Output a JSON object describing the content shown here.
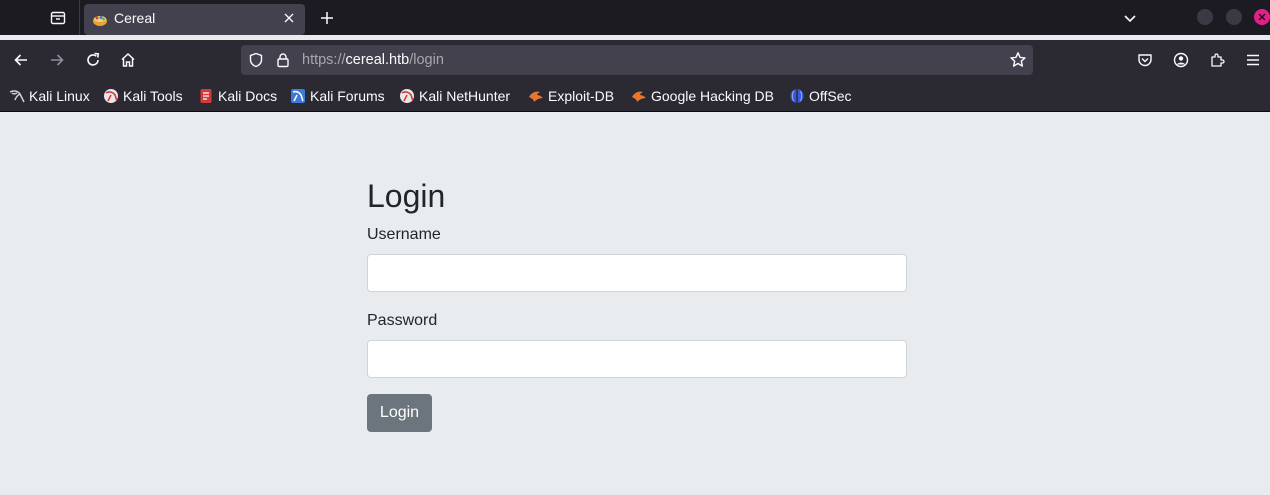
{
  "browser": {
    "tab": {
      "title": "Cereal",
      "active": true
    },
    "url": {
      "scheme": "https://",
      "host": "cereal.htb",
      "path": "/login"
    },
    "colors": {
      "tabbar": "#1c1b22",
      "toolbar": "#2b2a33",
      "urlbar": "#42414d",
      "close_button": "#e0218a"
    },
    "icons": [
      "tab-list-icon",
      "close-icon",
      "plus-icon",
      "chevron-down-icon",
      "back-arrow-icon",
      "forward-arrow-icon",
      "reload-icon",
      "home-icon",
      "shield-icon",
      "lock-icon",
      "star-icon",
      "pocket-icon",
      "account-icon",
      "extensions-icon",
      "menu-icon"
    ]
  },
  "bookmarks": [
    {
      "label": "Kali Linux",
      "icon": "kali-dragon-icon"
    },
    {
      "label": "Kali Tools",
      "icon": "kali-tools-icon"
    },
    {
      "label": "Kali Docs",
      "icon": "kali-docs-icon"
    },
    {
      "label": "Kali Forums",
      "icon": "kali-forums-icon"
    },
    {
      "label": "Kali NetHunter",
      "icon": "kali-nethunter-icon"
    },
    {
      "label": "Exploit-DB",
      "icon": "exploit-db-icon"
    },
    {
      "label": "Google Hacking DB",
      "icon": "ghdb-icon"
    },
    {
      "label": "OffSec",
      "icon": "offsec-icon"
    }
  ],
  "page": {
    "title": "Login",
    "username_label": "Username",
    "username_value": "",
    "password_label": "Password",
    "password_value": "",
    "submit_label": "Login",
    "colors": {
      "background": "#e9ecef",
      "button": "#6c757d",
      "text": "#212529"
    }
  }
}
